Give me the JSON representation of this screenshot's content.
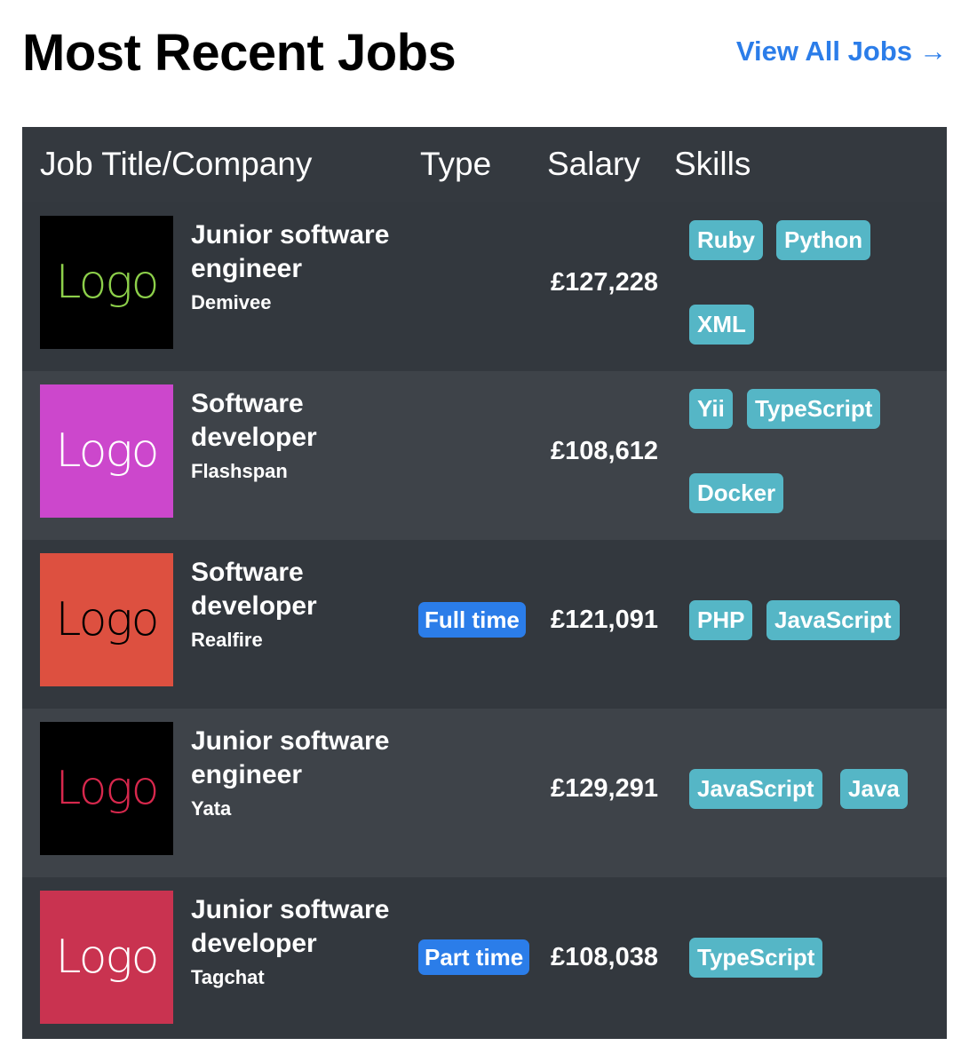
{
  "header": {
    "title": "Most Recent Jobs",
    "view_all_label": "View All Jobs",
    "view_all_arrow": "→"
  },
  "table": {
    "columns": [
      "Job Title/Company",
      "Type",
      "Salary",
      "Skills"
    ],
    "rows": [
      {
        "logo_text": "Logo",
        "logo_bg": "#000000",
        "logo_color": "#8dd04a",
        "title": "Junior software engineer",
        "company": "Demivee",
        "type": "",
        "salary": "£127,228",
        "skills": [
          "Ruby",
          "Python",
          "XML"
        ]
      },
      {
        "logo_text": "Logo",
        "logo_bg": "#cc47cc",
        "logo_color": "#ffffff",
        "title": "Software developer",
        "company": "Flashspan",
        "type": "",
        "salary": "£108,612",
        "skills": [
          "Yii",
          "TypeScript",
          "Docker"
        ]
      },
      {
        "logo_text": "Logo",
        "logo_bg": "#dd5040",
        "logo_color": "#000000",
        "title": "Software developer",
        "company": "Realfire",
        "type": "Full time",
        "salary": "£121,091",
        "skills": [
          "PHP",
          "JavaScript"
        ]
      },
      {
        "logo_text": "Logo",
        "logo_bg": "#000000",
        "logo_color": "#d8284d",
        "title": "Junior software engineer",
        "company": "Yata",
        "type": "",
        "salary": "£129,291",
        "skills": [
          "JavaScript",
          "Java"
        ]
      },
      {
        "logo_text": "Logo",
        "logo_bg": "#c93350",
        "logo_color": "#ffffff",
        "title": "Junior software developer",
        "company": "Tagchat",
        "type": "Part time",
        "salary": "£108,038",
        "skills": [
          "TypeScript"
        ]
      }
    ]
  },
  "colors": {
    "accent": "#2b7de9",
    "skill_badge": "#55b6c6",
    "table_bg_dark": "#33383e",
    "table_bg_light": "#3e4349"
  }
}
